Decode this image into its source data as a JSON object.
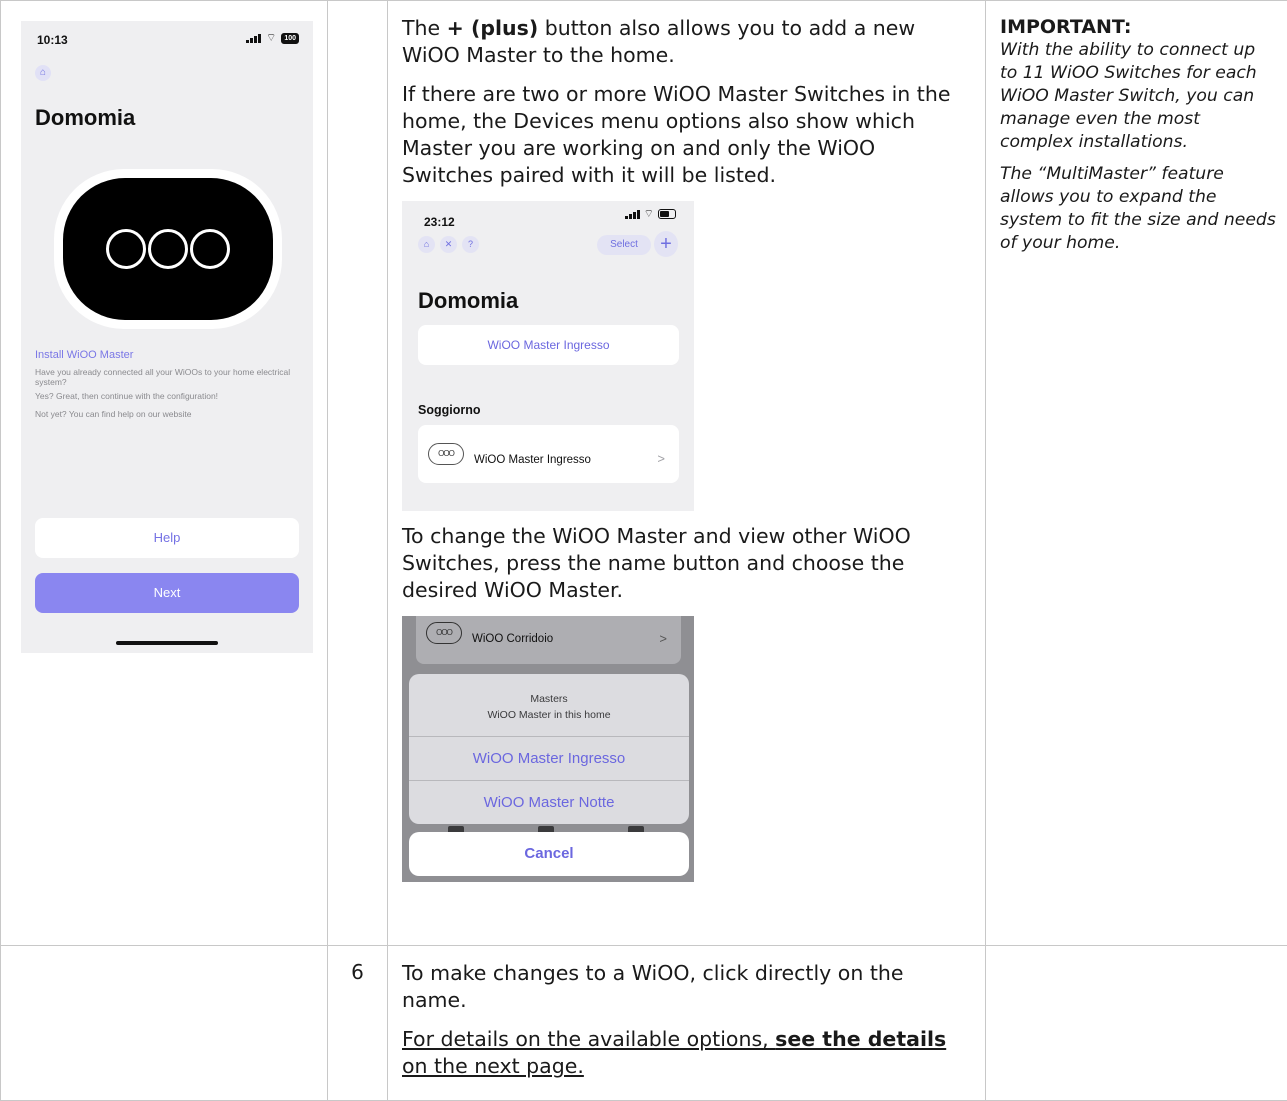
{
  "phone1": {
    "time": "10:13",
    "battery": "100",
    "title": "Domomia",
    "install_title": "Install WiOO Master",
    "line1": "Have you already connected all your WiOOs to your home electrical system?",
    "line2": "Yes? Great, then continue with the configuration!",
    "line3": "Not yet? You can find help on our website",
    "help_button": "Help",
    "next_button": "Next"
  },
  "row1": {
    "p1_bold": "+ (plus)",
    "p1_rest": " button also allows you to add a new WiOO Master to the home.",
    "p1_pre": "The ",
    "p2": "If there are two or more WiOO Master Switches in the home, the Devices menu options also show which Master you are working on and only the WiOO Switches paired with it will be listed.",
    "p3": "To change the WiOO Master and view other WiOO Switches, press the name button and choose the desired WiOO Master."
  },
  "phone2": {
    "time": "23:12",
    "help_icon": "?",
    "select_button": "Select",
    "plus_button": "+",
    "title": "Domomia",
    "master_button": "WiOO Master Ingresso",
    "room": "Soggiorno",
    "item_label": "WiOO Master Ingresso",
    "device_pill": "OOO"
  },
  "phone3": {
    "item_label": "WiOO Corridoio",
    "sheet_title": "Masters",
    "sheet_subtitle": "WiOO Master in this home",
    "option1": "WiOO Master Ingresso",
    "option2": "WiOO Master Notte",
    "cancel": "Cancel"
  },
  "note": {
    "title": "IMPORTANT:",
    "p1": "With the ability to connect up to 11 WiOO Switches for each WiOO Master Switch, you can manage even the most complex installations.",
    "p2": "The “MultiMaster” feature allows you to expand the system to fit the size and needs of your home."
  },
  "row2": {
    "number": "6",
    "p1": "To make changes to a WiOO, click directly on the name.",
    "link_pre": "For details on the available options, ",
    "link_bold": "see the details",
    "link_post": " on the next page."
  },
  "colors": {
    "accent": "#7471e4",
    "next_button": "#8a86f0",
    "border": "#c8c8c8"
  }
}
